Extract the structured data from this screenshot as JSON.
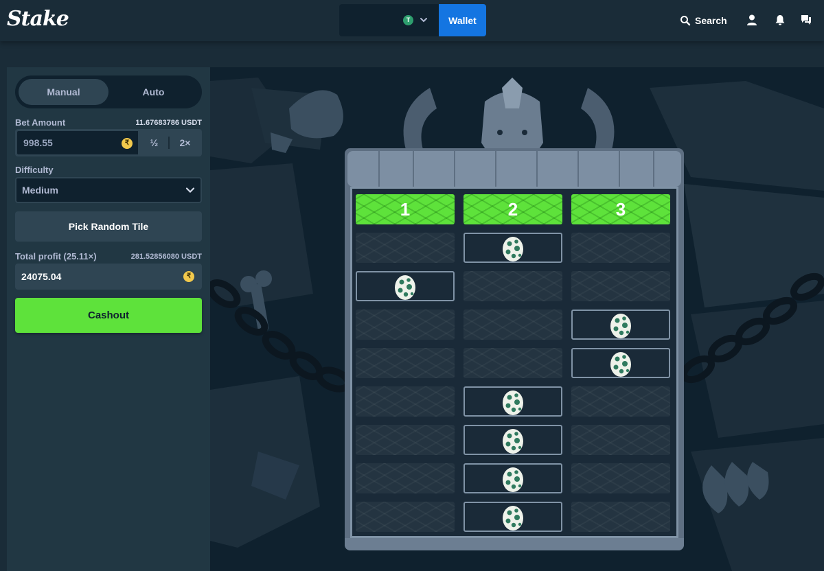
{
  "header": {
    "logo": "Stake",
    "currency_icon": "T",
    "wallet_label": "Wallet",
    "search_label": "Search"
  },
  "sidebar": {
    "modes": [
      "Manual",
      "Auto"
    ],
    "active_mode": "Manual",
    "bet_amount_label": "Bet Amount",
    "bet_amount_usdt": "11.67683786 USDT",
    "bet_value": "998.55",
    "half_label": "½",
    "double_label": "2×",
    "difficulty_label": "Difficulty",
    "difficulty_value": "Medium",
    "random_tile_label": "Pick Random Tile",
    "total_profit_label": "Total profit (25.11×)",
    "total_profit_usdt": "281.52856080 USDT",
    "profit_value": "24075.04",
    "cashout_label": "Cashout",
    "currency_symbol": "₹"
  },
  "game": {
    "columns": [
      "1",
      "2",
      "3"
    ],
    "rows": [
      [
        false,
        true,
        false
      ],
      [
        true,
        false,
        false
      ],
      [
        false,
        false,
        true
      ],
      [
        false,
        false,
        true
      ],
      [
        false,
        true,
        false
      ],
      [
        false,
        true,
        false
      ],
      [
        false,
        true,
        false
      ],
      [
        false,
        true,
        false
      ]
    ]
  },
  "colors": {
    "accent_green": "#5ee23b",
    "wallet_blue": "#1475e1",
    "panel": "#213743",
    "bg": "#1a2c38",
    "input_bg": "#0f212e"
  }
}
